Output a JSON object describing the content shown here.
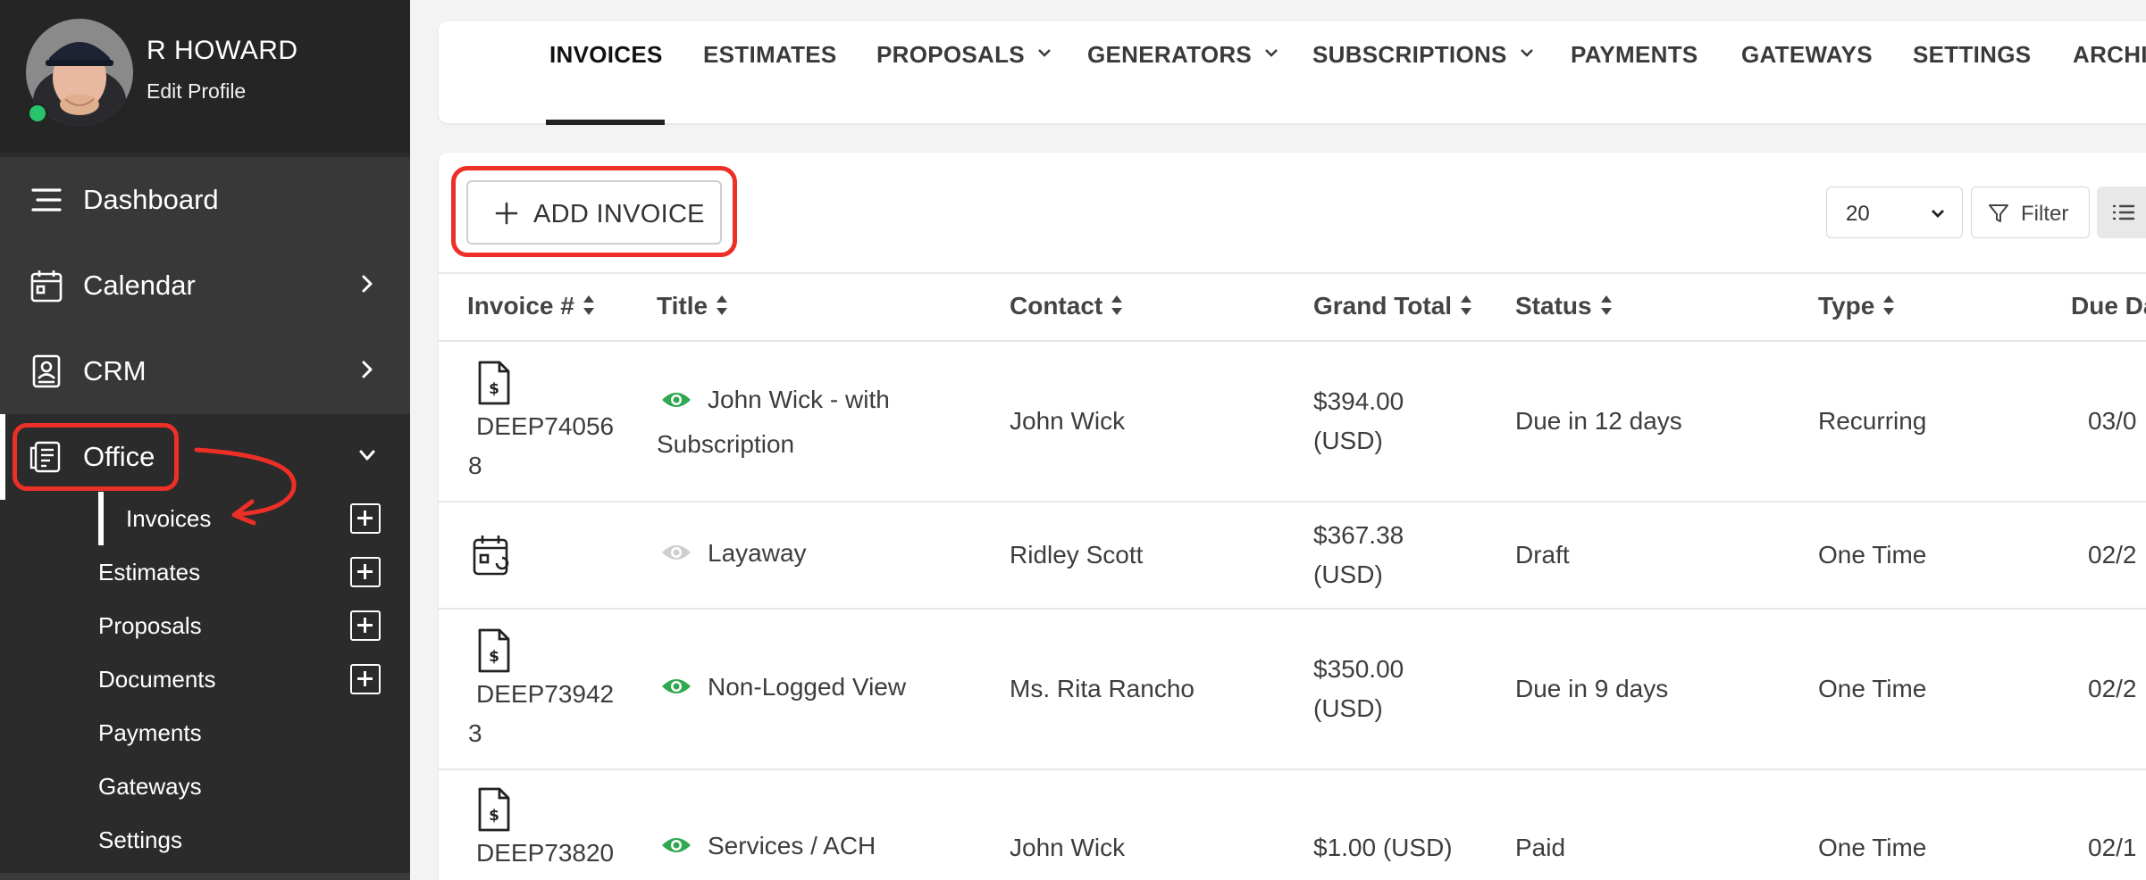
{
  "sidebar": {
    "profile": {
      "name": "R HOWARD",
      "edit_label": "Edit Profile"
    },
    "nav": {
      "dashboard": "Dashboard",
      "calendar": "Calendar",
      "crm": "CRM",
      "office": "Office"
    },
    "office_sub": {
      "invoices": "Invoices",
      "estimates": "Estimates",
      "proposals": "Proposals",
      "documents": "Documents",
      "payments": "Payments",
      "gateways": "Gateways",
      "settings": "Settings"
    }
  },
  "tabs": {
    "invoices": "INVOICES",
    "estimates": "ESTIMATES",
    "proposals": "PROPOSALS",
    "generators": "GENERATORS",
    "subscriptions": "SUBSCRIPTIONS",
    "payments": "PAYMENTS",
    "gateways": "GATEWAYS",
    "settings": "SETTINGS",
    "archive": "ARCHI"
  },
  "toolbar": {
    "add_invoice": "ADD INVOICE",
    "per_page": "20",
    "filter": "Filter"
  },
  "table": {
    "headers": {
      "invoice_no": "Invoice #",
      "title": "Title",
      "contact": "Contact",
      "grand_total": "Grand Total",
      "status": "Status",
      "type": "Type",
      "due_date": "Due Da"
    },
    "rows": [
      {
        "icon": "invoice-doc-icon",
        "invoice_l1": "DEEP74056",
        "invoice_l2": "8",
        "viewed": true,
        "title_l1": "John Wick - with",
        "title_l2": "Subscription",
        "contact": "John Wick",
        "total_l1": "$394.00",
        "total_l2": "(USD)",
        "status": "Due in 12 days",
        "type": "Recurring",
        "due": "03/0"
      },
      {
        "icon": "calendar-icon",
        "invoice_l1": "",
        "invoice_l2": "",
        "viewed": false,
        "title_l1": "Layaway",
        "title_l2": "",
        "contact": "Ridley Scott",
        "total_l1": "$367.38",
        "total_l2": "(USD)",
        "status": "Draft",
        "type": "One Time",
        "due": "02/2"
      },
      {
        "icon": "invoice-doc-icon",
        "invoice_l1": "DEEP73942",
        "invoice_l2": "3",
        "viewed": true,
        "title_l1": "Non-Logged View",
        "title_l2": "",
        "contact": "Ms. Rita Rancho",
        "total_l1": "$350.00",
        "total_l2": "(USD)",
        "status": "Due in 9 days",
        "type": "One Time",
        "due": "02/2"
      },
      {
        "icon": "invoice-doc-icon",
        "invoice_l1": "DEEP73820",
        "invoice_l2": "",
        "viewed": true,
        "title_l1": "Services / ACH",
        "title_l2": "",
        "contact": "John Wick",
        "total_l1": "$1.00 (USD)",
        "total_l2": "",
        "status": "Paid",
        "type": "One Time",
        "due": "02/1"
      }
    ]
  },
  "colors": {
    "highlight": "#ec2f27",
    "viewed_eye": "#2fa84f",
    "unviewed_eye": "#cfcfcf",
    "sidebar_bg": "#2b2b2b"
  }
}
